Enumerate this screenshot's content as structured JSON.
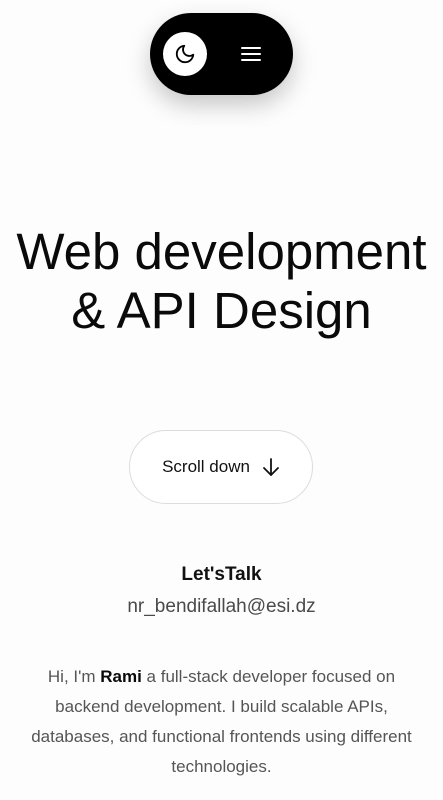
{
  "nav": {
    "theme_toggle_icon": "moon-icon",
    "menu_icon": "hamburger-menu-icon"
  },
  "hero": {
    "title": "Web development & API Design",
    "scroll_button_label": "Scroll down",
    "scroll_button_icon": "arrow-down-icon"
  },
  "contact": {
    "heading": "Let'sTalk",
    "email": "nr_bendifallah@esi.dz"
  },
  "bio": {
    "prefix": "Hi, I'm ",
    "name": "Rami",
    "suffix": " a full-stack developer focused on backend development. I build scalable APIs, databases, and functional frontends using different technologies."
  },
  "colors": {
    "nav_background": "#000000",
    "page_background": "#fdfdfd",
    "text_primary": "#0a0a0a",
    "text_muted": "#555555"
  }
}
